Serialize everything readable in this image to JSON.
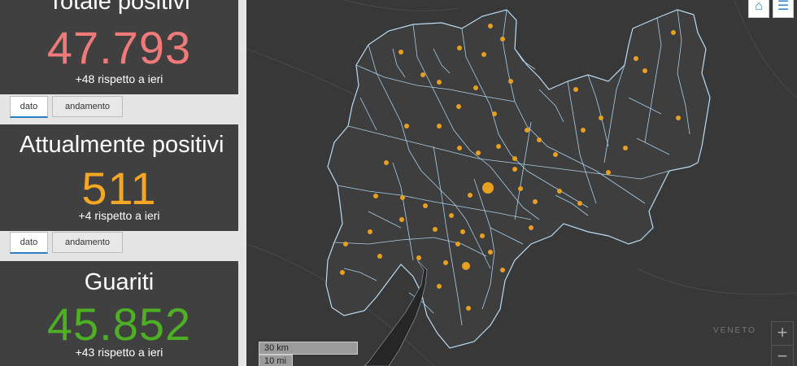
{
  "cards": [
    {
      "title": "Totale positivi",
      "value": "47.793",
      "delta": "+48 rispetto a ieri",
      "color": "#f07a7a"
    },
    {
      "title": "Attualmente positivi",
      "value": "511",
      "delta": "+4 rispetto a ieri",
      "color": "#f5a623"
    },
    {
      "title": "Guariti",
      "value": "45.852",
      "delta": "+43 rispetto a ieri",
      "color": "#4caf24"
    }
  ],
  "tabs": {
    "dato": "dato",
    "andamento": "andamento"
  },
  "map": {
    "home_icon": "home-icon",
    "legend_icon": "list-icon",
    "zoom_in": "+",
    "zoom_out": "−",
    "scale_km": "30 km",
    "scale_mi": "10 mi",
    "region_label": "VENETO"
  },
  "colors": {
    "boundary": "#a9cfe8",
    "dot": "#e8a020",
    "map_bg": "#383838",
    "lake": "#262626"
  }
}
